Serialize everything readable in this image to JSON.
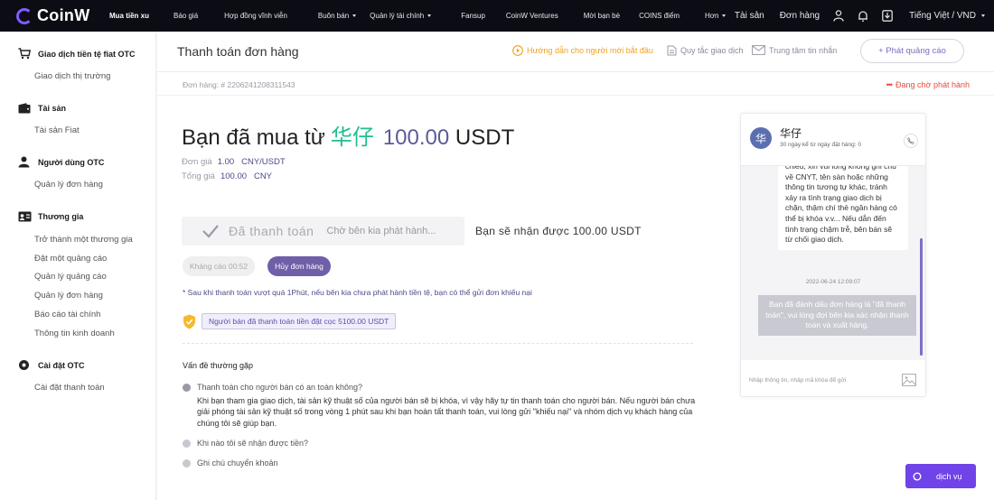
{
  "nav": {
    "brand": "CoinW",
    "items": [
      {
        "label": "Mua tiền xu",
        "active": true,
        "caret": false
      },
      {
        "label": "Báo giá",
        "caret": false
      },
      {
        "label": "Hợp đồng vĩnh viễn",
        "caret": false
      },
      {
        "label": "Buôn bán",
        "caret": true
      },
      {
        "label": "Quản lý tài chính",
        "caret": true
      },
      {
        "label": "Fansup",
        "caret": false
      },
      {
        "label": "CoinW Ventures",
        "caret": false
      },
      {
        "label": "Mời bạn bè",
        "caret": false
      },
      {
        "label": "COINS điểm",
        "caret": false
      },
      {
        "label": "Hơn",
        "caret": true
      }
    ],
    "assets": "Tài sản",
    "orders": "Đơn hàng",
    "language": "Tiếng Việt / VND"
  },
  "sidebar": {
    "sections": [
      {
        "title": "Giao dịch tiền tệ fiat OTC",
        "icon": "cart-icon",
        "links": [
          "Giao dịch thị trường"
        ]
      },
      {
        "title": "Tài sản",
        "icon": "wallet-icon",
        "links": [
          "Tài sản Fiat"
        ]
      },
      {
        "title": "Người dùng OTC",
        "icon": "user-icon",
        "links": [
          "Quản lý đơn hàng"
        ]
      },
      {
        "title": "Thương gia",
        "icon": "merchant-icon",
        "links": [
          "Trở thành một thương gia",
          "Đặt một quảng cáo",
          "Quản lý quảng cáo",
          "Quản lý đơn hàng",
          "Báo cáo tài chính",
          "Thông tin kinh doanh"
        ]
      },
      {
        "title": "Cài đặt OTC",
        "icon": "settings-icon",
        "links": [
          "Cài đặt thanh toán"
        ]
      }
    ]
  },
  "header": {
    "title": "Thanh toán đơn hàng",
    "guide": "Hướng dẫn cho người mới bắt đầu",
    "rules": "Quy tắc giao dịch",
    "messages": "Trung tâm tin nhắn",
    "post_ad": "+ Phát quảng cáo"
  },
  "order": {
    "number": "Đơn hàng: # 2206241208311543",
    "status": "Đang chờ phát hành",
    "bought_from": "Bạn đã mua từ",
    "seller": "华仔",
    "amount": "100.00",
    "currency": "USDT",
    "unit_price_label": "Đơn giá",
    "unit_price": "1.00   CNY/USDT",
    "total_label": "Tổng giá",
    "total": "100.00   CNY",
    "paid_label": "Đã thanh toán",
    "waiting_text": "Chờ bên kia phát hành...",
    "receive_text": "Bạn sẽ nhận được 100.00 USDT",
    "appeal_label": "Kháng cáo 00:52",
    "cancel_label": "Hủy đơn hàng",
    "note": "* Sau khi thanh toán vượt quá 1Phút, nếu bên kia chưa phát hành tiền tệ, bạn có thể gửi đơn khiếu nại",
    "deposit": "Người bán đã thanh toán tiền đặt cọc 5100.00 USDT"
  },
  "faq": {
    "title": "Vấn đề thường gặp",
    "items": [
      {
        "q": "Thanh toán cho người bán có an toàn không?",
        "open": true
      },
      {
        "q": "Khi nào tôi sẽ nhận được tiền?",
        "open": false
      },
      {
        "q": "Ghi chú chuyển khoản",
        "open": false
      }
    ],
    "answer": "Khi bạn tham gia giao dịch, tài sản kỹ thuật số của người bán sẽ bị khóa, vì vậy hãy tự tin thanh toán cho người bán. Nếu người bán chưa giải phóng tài sản kỹ thuật số trong vòng 1 phút sau khi bạn hoàn tất thanh toán, vui lòng gửi \"khiếu nại\" và nhóm dịch vụ khách hàng của chúng tôi sẽ giúp bạn."
  },
  "chat": {
    "avatar": "华",
    "name": "华仔",
    "subtitle": "30 ngày kể từ ngày đặt hàng: 0",
    "incoming": "chiếu, xin vui lòng không ghi chú về CNYT, tên sàn hoặc những thông tin tương tự khác, tránh xảy ra tình trạng giao dịch bị chặn, thậm chí thẻ ngân hàng có thể bị khóa v.v... Nếu dẫn đến tình trạng chậm trễ, bên bán sẽ từ chối giao dịch.",
    "time": "2022-06-24 12:09:07",
    "outgoing": "Bạn đã đánh dấu đơn hàng là \"đã thanh toán\", vui lòng đợi bên kia xác nhận thanh toán và xuất hàng.",
    "input_placeholder": "Nhập thông tin, nhập mã khóa để gửi"
  },
  "service": {
    "label": "dịch vụ"
  },
  "colors": {
    "accent": "#6f5ea8",
    "seller": "#1fbf8f",
    "status": "#e74c3c",
    "brand": "#7f5cff"
  }
}
